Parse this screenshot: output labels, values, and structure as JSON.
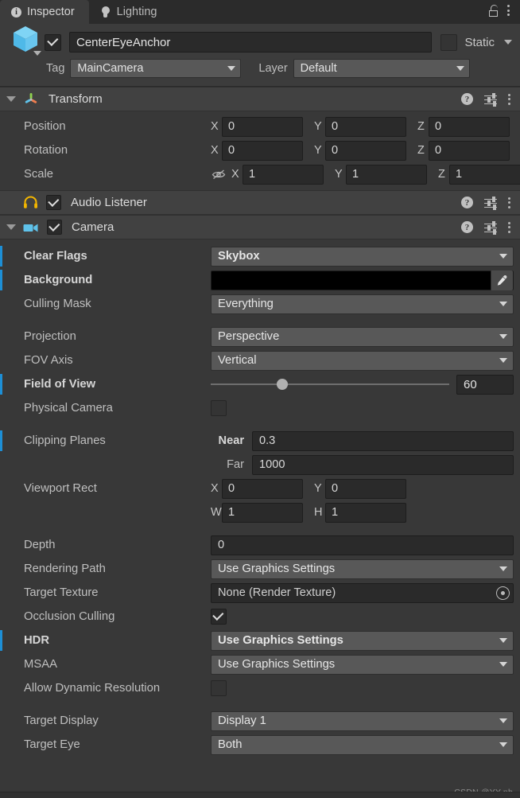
{
  "tabs": [
    {
      "label": "Inspector",
      "icon": "info-icon",
      "active": true
    },
    {
      "label": "Lighting",
      "icon": "bulb-icon",
      "active": false
    }
  ],
  "tabbar_actions": [
    {
      "name": "lock-icon",
      "label": "Lock"
    },
    {
      "name": "kebab-menu-icon",
      "label": "More"
    }
  ],
  "object_header": {
    "icon": "gameobject-cube-icon",
    "enabled": true,
    "name_value": "CenterEyeAnchor",
    "static_label": "Static",
    "static_checked": false,
    "tag_label": "Tag",
    "tag_value": "MainCamera",
    "layer_label": "Layer",
    "layer_value": "Default"
  },
  "colors": {
    "override_bar": "#1d8fd6",
    "background_color_value": "#000000",
    "accent_cube": "#63c8f0",
    "accent_headphones": "#f2b500"
  },
  "components": [
    {
      "title": "Transform",
      "icon": "transform-gizmo-icon",
      "expanded": true,
      "has_enable_toggle": false,
      "rows": [
        {
          "label": "Position",
          "type": "vector3",
          "axes": [
            "X",
            "Y",
            "Z"
          ],
          "values": [
            "0",
            "0",
            "0"
          ],
          "override": false,
          "bold": false
        },
        {
          "label": "Rotation",
          "type": "vector3",
          "axes": [
            "X",
            "Y",
            "Z"
          ],
          "values": [
            "0",
            "0",
            "0"
          ],
          "override": false,
          "bold": false
        },
        {
          "label": "Scale",
          "type": "vector3",
          "axes": [
            "X",
            "Y",
            "Z"
          ],
          "values": [
            "1",
            "1",
            "1"
          ],
          "override": false,
          "bold": false,
          "lock_icon": "constrain-proportions-off-icon"
        }
      ]
    },
    {
      "title": "Audio Listener",
      "icon": "headphones-icon",
      "expanded": false,
      "has_enable_toggle": true,
      "enabled": true,
      "rows": []
    },
    {
      "title": "Camera",
      "icon": "camera-icon",
      "expanded": true,
      "has_enable_toggle": true,
      "enabled": true,
      "rows": [
        {
          "label": "Clear Flags",
          "type": "dropdown",
          "value": "Skybox",
          "override": true,
          "bold": true
        },
        {
          "label": "Background",
          "type": "color",
          "value": "#000000",
          "override": true,
          "bold": true
        },
        {
          "label": "Culling Mask",
          "type": "dropdown",
          "value": "Everything",
          "override": false,
          "bold": false
        },
        {
          "label": "Projection",
          "type": "dropdown",
          "value": "Perspective",
          "override": false,
          "bold": false,
          "gap_before": true
        },
        {
          "label": "FOV Axis",
          "type": "dropdown",
          "value": "Vertical",
          "override": false,
          "bold": false
        },
        {
          "label": "Field of View",
          "type": "slider",
          "value": "60",
          "slider_pct": 27.5,
          "override": true,
          "bold": true
        },
        {
          "label": "Physical Camera",
          "type": "checkbox",
          "checked": false,
          "override": false,
          "bold": false
        },
        {
          "label": "Clipping Planes",
          "type": "clipping",
          "near_label": "Near",
          "near_value": "0.3",
          "far_label": "Far",
          "far_value": "1000",
          "override": true,
          "bold": false,
          "near_bold": true,
          "gap_before": true
        },
        {
          "label": "Viewport Rect",
          "type": "rect",
          "x_label": "X",
          "x_value": "0",
          "y_label": "Y",
          "y_value": "0",
          "w_label": "W",
          "w_value": "1",
          "h_label": "H",
          "h_value": "1",
          "override": false,
          "bold": false
        },
        {
          "label": "Depth",
          "type": "text",
          "value": "0",
          "override": false,
          "bold": false,
          "gap_before": true
        },
        {
          "label": "Rendering Path",
          "type": "dropdown",
          "value": "Use Graphics Settings",
          "override": false,
          "bold": false
        },
        {
          "label": "Target Texture",
          "type": "object",
          "value": "None (Render Texture)",
          "override": false,
          "bold": false
        },
        {
          "label": "Occlusion Culling",
          "type": "checkbox",
          "checked": true,
          "override": false,
          "bold": false
        },
        {
          "label": "HDR",
          "type": "dropdown",
          "value": "Use Graphics Settings",
          "override": true,
          "bold": true
        },
        {
          "label": "MSAA",
          "type": "dropdown",
          "value": "Use Graphics Settings",
          "override": false,
          "bold": false
        },
        {
          "label": "Allow Dynamic Resolution",
          "type": "checkbox",
          "checked": false,
          "override": false,
          "bold": false
        },
        {
          "label": "Target Display",
          "type": "dropdown",
          "value": "Display 1",
          "override": false,
          "bold": false,
          "gap_before": true
        },
        {
          "label": "Target Eye",
          "type": "dropdown",
          "value": "Both",
          "override": false,
          "bold": false
        }
      ]
    }
  ],
  "watermark": "CSDN @YY-nb"
}
